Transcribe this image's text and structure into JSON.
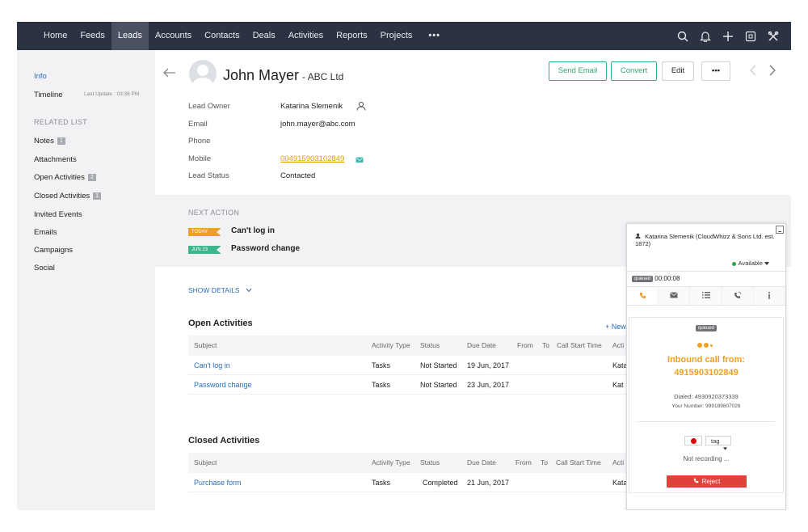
{
  "nav": {
    "items": [
      "Home",
      "Feeds",
      "Leads",
      "Accounts",
      "Contacts",
      "Deals",
      "Activities",
      "Reports",
      "Projects"
    ],
    "more": "•••",
    "active_index": 2
  },
  "sidebar": {
    "info": "Info",
    "timeline": "Timeline",
    "last_update": "Last Update : 03:38 PM",
    "related_head": "RELATED LIST",
    "items": [
      {
        "label": "Notes",
        "count": "1"
      },
      {
        "label": "Attachments",
        "count": ""
      },
      {
        "label": "Open Activities",
        "count": "2"
      },
      {
        "label": "Closed Activities",
        "count": "1"
      },
      {
        "label": "Invited Events",
        "count": ""
      },
      {
        "label": "Emails",
        "count": ""
      },
      {
        "label": "Campaigns",
        "count": ""
      },
      {
        "label": "Social",
        "count": ""
      }
    ]
  },
  "lead": {
    "name": "John Mayer",
    "company": "- ABC Ltd"
  },
  "buttons": {
    "send_email": "Send Email",
    "convert": "Convert",
    "edit": "Edit",
    "more": "•••"
  },
  "fields": [
    {
      "label": "Lead Owner",
      "value": "Katarina Slemenik"
    },
    {
      "label": "Email",
      "value": "john.mayer@abc.com"
    },
    {
      "label": "Phone",
      "value": ""
    },
    {
      "label": "Mobile",
      "value": "004915903102849"
    },
    {
      "label": "Lead Status",
      "value": "Contacted"
    }
  ],
  "next_action": {
    "heading": "NEXT ACTION",
    "items": [
      {
        "tag": "TODAY",
        "text": "Can't log in",
        "color": "#f0a020"
      },
      {
        "tag": "JUN 23",
        "text": "Password change",
        "color": "#3fb58c"
      }
    ]
  },
  "show_details": "SHOW DETAILS",
  "open_activities": {
    "title": "Open Activities",
    "new_label": "+ New",
    "headers": [
      "Subject",
      "Activity Type",
      "Status",
      "Due Date",
      "From",
      "To",
      "Call Start Time",
      "Acti"
    ],
    "rows": [
      {
        "subject": "Can't log in",
        "type": "Tasks",
        "status": "Not Started",
        "due": "19 Jun, 2017",
        "owner": "Kata"
      },
      {
        "subject": "Password change",
        "type": "Tasks",
        "status": "Not Started",
        "due": "23 Jun, 2017",
        "owner": "Kat"
      }
    ]
  },
  "closed_activities": {
    "title": "Closed Activities",
    "headers": [
      "Subject",
      "Activity Type",
      "Status",
      "Due Date",
      "From",
      "To",
      "Call Start Time",
      "Acti"
    ],
    "rows": [
      {
        "subject": "Purchase form",
        "type": "Tasks",
        "status": "Completed",
        "due": "21 Jun, 2017",
        "owner": "Kata"
      }
    ]
  },
  "widget": {
    "agent": "Katarina Slemenik (CloudWhizz & Sons Ltd. est. 1872)",
    "status": "Available",
    "queued": "queued",
    "timer": "00:00:08",
    "inbound_label": "Inbound call from:",
    "inbound_number": "4915903102849",
    "dialed": "Dialed: 4930920373339",
    "your_number": "Your Number: 999189807026",
    "tag": "tag",
    "recording": "Not recording ...",
    "reject": "Reject"
  },
  "colors": {
    "nav_bg": "#2b3242",
    "accent_green": "#33a66f",
    "accent_orange": "#f0a020",
    "link_blue": "#2a6eb8",
    "reject_red": "#e0413b"
  }
}
